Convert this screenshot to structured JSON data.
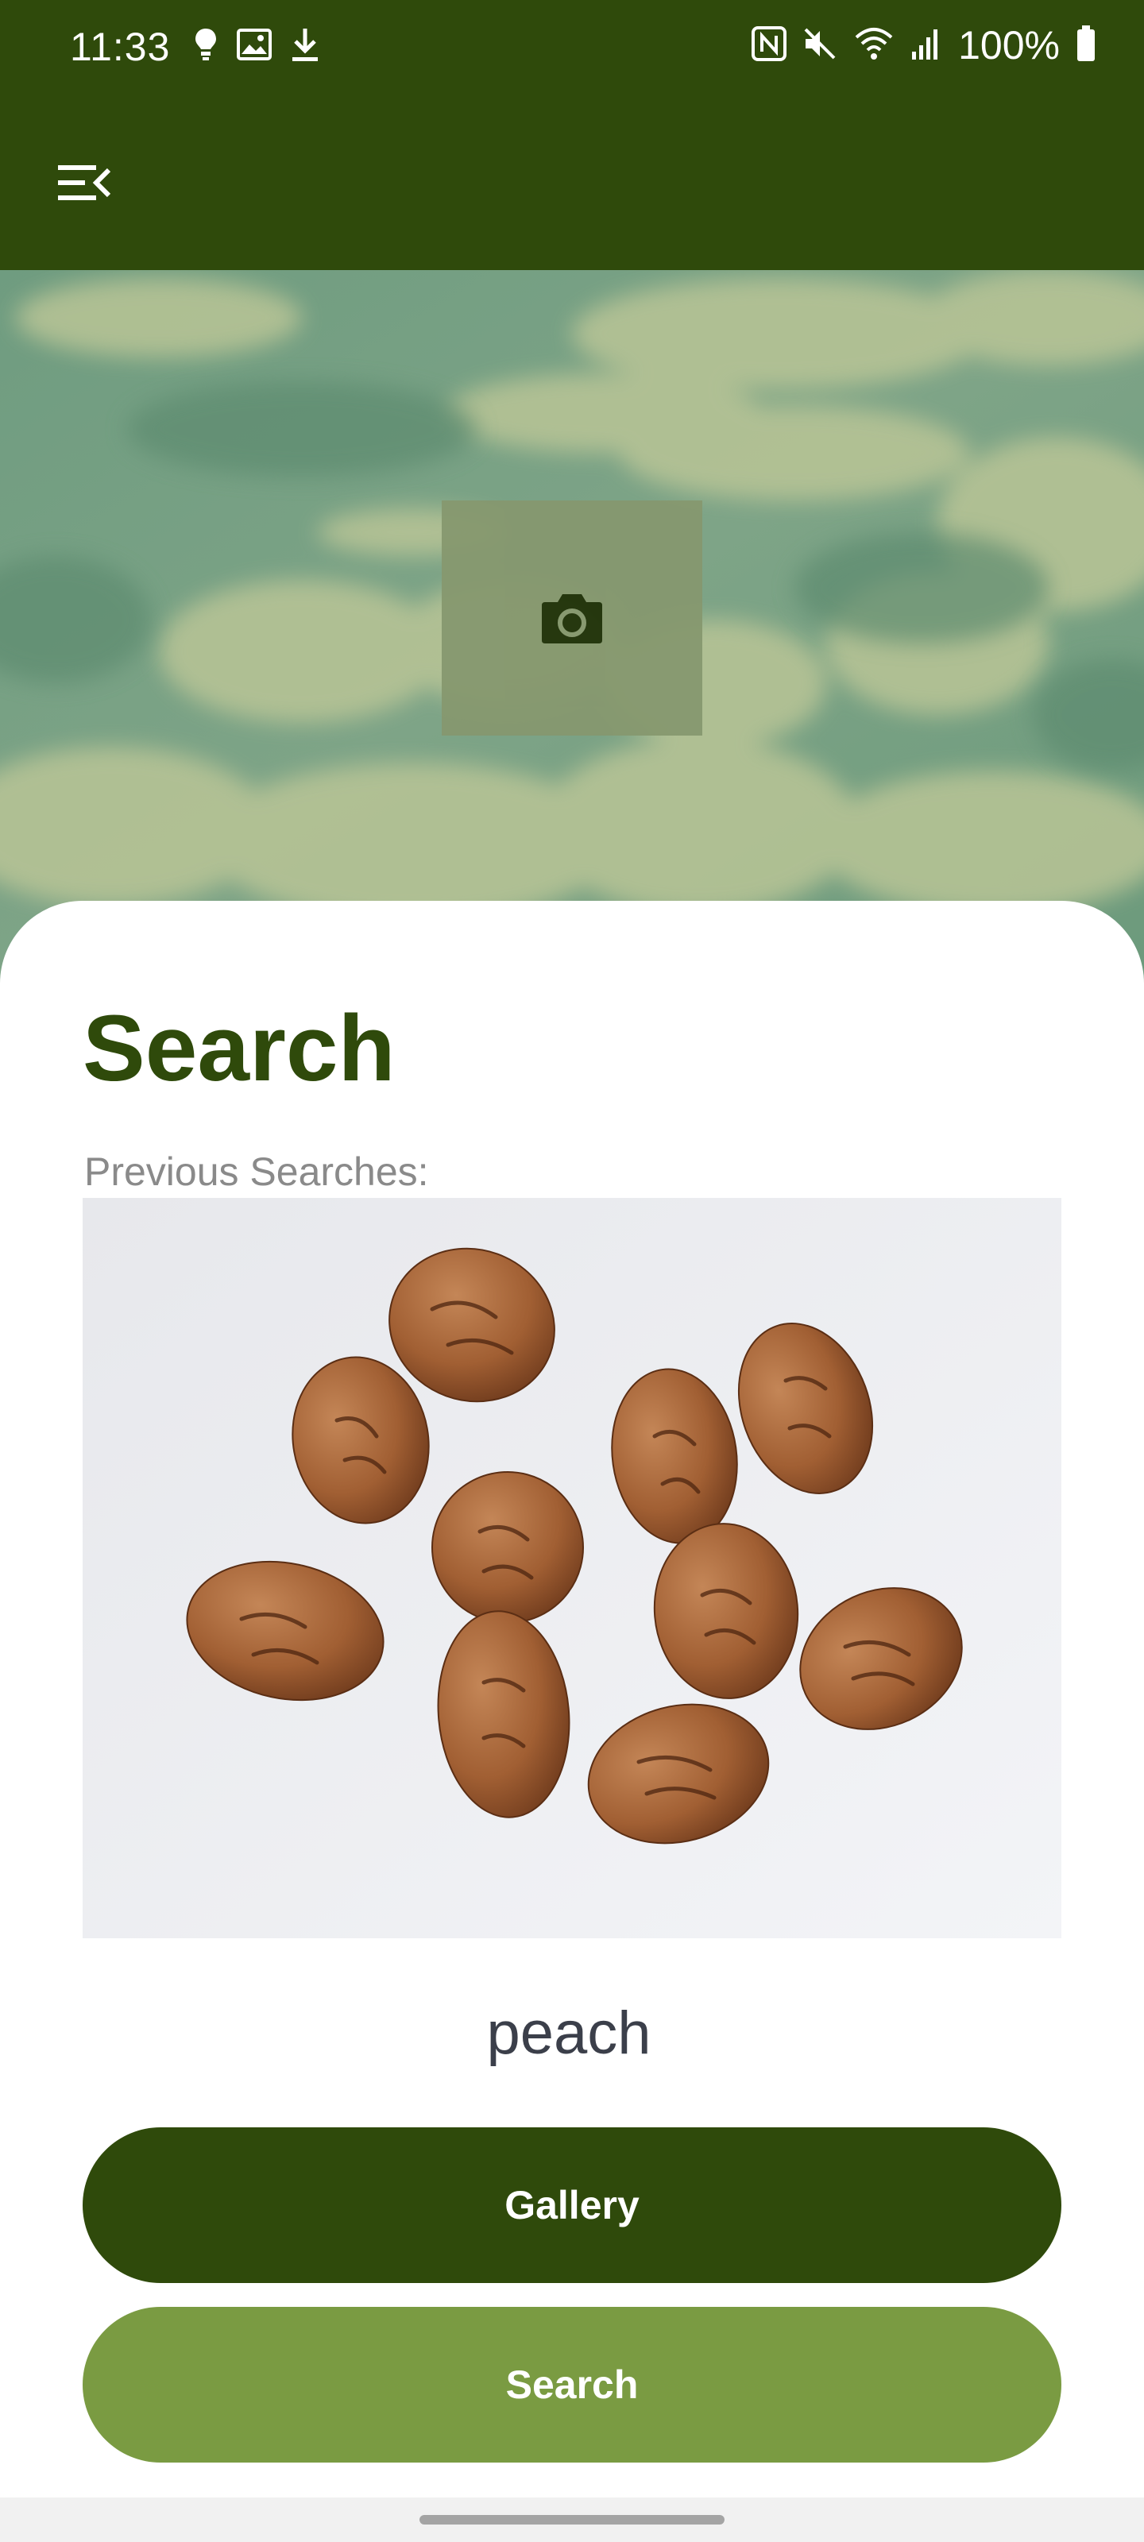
{
  "status_bar": {
    "time": "11:33",
    "battery": "100%",
    "left_icons": [
      "bulb-icon",
      "image-icon",
      "download-icon"
    ],
    "right_icons": [
      "nfc-icon",
      "mute-icon",
      "wifi-icon",
      "signal-icon",
      "battery-icon"
    ]
  },
  "app_bar": {
    "menu_icon": "menu-collapse-icon"
  },
  "hero": {
    "camera_icon": "camera-icon"
  },
  "main": {
    "title": "Search",
    "previous_label": "Previous Searches:",
    "result_label": "peach"
  },
  "buttons": {
    "gallery": "Gallery",
    "search": "Search"
  },
  "colors": {
    "primary": "#2f4a0b",
    "accent": "#7a9b42",
    "label_gray": "#8a8a8a"
  }
}
